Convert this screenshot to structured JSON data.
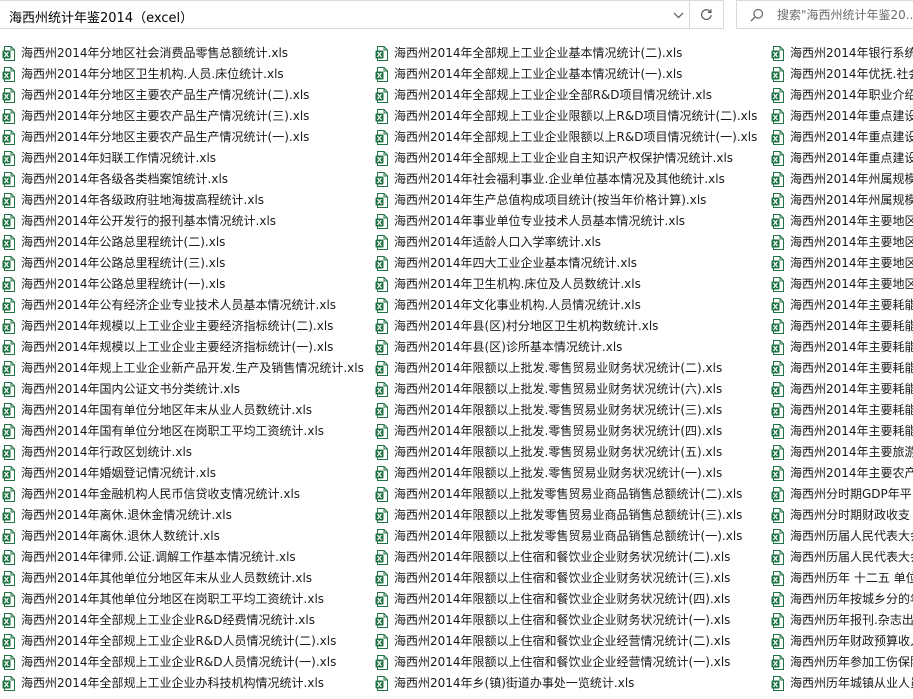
{
  "address": {
    "path_text": "海西州统计年鉴2014（excel）"
  },
  "search": {
    "placeholder": "搜索\"海西州统计年鉴20..."
  },
  "icons": {
    "dropdown": "chevron-down-icon",
    "refresh": "refresh-icon",
    "search": "search-icon",
    "file": "excel-file-icon"
  },
  "colors": {
    "excel_green": "#217346",
    "border": "#d9d9d9"
  },
  "files": {
    "column1": [
      "海西州2014年分地区社会消费品零售总额统计.xls",
      "海西州2014年分地区卫生机构.人员.床位统计.xls",
      "海西州2014年分地区主要农产品生产情况统计(二).xls",
      "海西州2014年分地区主要农产品生产情况统计(三).xls",
      "海西州2014年分地区主要农产品生产情况统计(一).xls",
      "海西州2014年妇联工作情况统计.xls",
      "海西州2014年各级各类档案馆统计.xls",
      "海西州2014年各级政府驻地海拔高程统计.xls",
      "海西州2014年公开发行的报刊基本情况统计.xls",
      "海西州2014年公路总里程统计(二).xls",
      "海西州2014年公路总里程统计(三).xls",
      "海西州2014年公路总里程统计(一).xls",
      "海西州2014年公有经济企业专业技术人员基本情况统计.xls",
      "海西州2014年规模以上工业企业主要经济指标统计(二).xls",
      "海西州2014年规模以上工业企业主要经济指标统计(一).xls",
      "海西州2014年规上工业企业新产品开发.生产及销售情况统计.xls",
      "海西州2014年国内公证文书分类统计.xls",
      "海西州2014年国有单位分地区年末从业人员数统计.xls",
      "海西州2014年国有单位分地区在岗职工平均工资统计.xls",
      "海西州2014年行政区划统计.xls",
      "海西州2014年婚姻登记情况统计.xls",
      "海西州2014年金融机构人民币信贷收支情况统计.xls",
      "海西州2014年离休.退休金情况统计.xls",
      "海西州2014年离休.退休人数统计.xls",
      "海西州2014年律师.公证.调解工作基本情况统计.xls",
      "海西州2014年其他单位分地区年末从业人员数统计.xls",
      "海西州2014年其他单位分地区在岗职工平均工资统计.xls",
      "海西州2014年全部规上工业企业R&D经费情况统计.xls",
      "海西州2014年全部规上工业企业R&D人员情况统计(二).xls",
      "海西州2014年全部规上工业企业R&D人员情况统计(一).xls",
      "海西州2014年全部规上工业企业办科技机构情况统计.xls"
    ],
    "column2": [
      "海西州2014年全部规上工业企业基本情况统计(二).xls",
      "海西州2014年全部规上工业企业基本情况统计(一).xls",
      "海西州2014年全部规上工业企业全部R&D项目情况统计.xls",
      "海西州2014年全部规上工业企业限额以上R&D项目情况统计(二).xls",
      "海西州2014年全部规上工业企业限额以上R&D项目情况统计(一).xls",
      "海西州2014年全部规上工业企业自主知识产权保护情况统计.xls",
      "海西州2014年社会福利事业.企业单位基本情况及其他统计.xls",
      "海西州2014年生产总值构成项目统计(按当年价格计算).xls",
      "海西州2014年事业单位专业技术人员基本情况统计.xls",
      "海西州2014年适龄人口入学率统计.xls",
      "海西州2014年四大工业企业基本情况统计.xls",
      "海西州2014年卫生机构.床位及人员数统计.xls",
      "海西州2014年文化事业机构.人员情况统计.xls",
      "海西州2014年县(区)村分地区卫生机构数统计.xls",
      "海西州2014年县(区)诊所基本情况统计.xls",
      "海西州2014年限额以上批发.零售贸易业财务状况统计(二).xls",
      "海西州2014年限额以上批发.零售贸易业财务状况统计(六).xls",
      "海西州2014年限额以上批发.零售贸易业财务状况统计(三).xls",
      "海西州2014年限额以上批发.零售贸易业财务状况统计(四).xls",
      "海西州2014年限额以上批发.零售贸易业财务状况统计(五).xls",
      "海西州2014年限额以上批发.零售贸易业财务状况统计(一).xls",
      "海西州2014年限额以上批发零售贸易业商品销售总额统计(二).xls",
      "海西州2014年限额以上批发零售贸易业商品销售总额统计(三).xls",
      "海西州2014年限额以上批发零售贸易业商品销售总额统计(一).xls",
      "海西州2014年限额以上住宿和餐饮业企业财务状况统计(二).xls",
      "海西州2014年限额以上住宿和餐饮业企业财务状况统计(三).xls",
      "海西州2014年限额以上住宿和餐饮业企业财务状况统计(四).xls",
      "海西州2014年限额以上住宿和餐饮业企业财务状况统计(一).xls",
      "海西州2014年限额以上住宿和餐饮业企业经营情况统计(二).xls",
      "海西州2014年限额以上住宿和餐饮业企业经营情况统计(一).xls",
      "海西州2014年乡(镇)街道办事处一览统计.xls"
    ],
    "column3": [
      "海西州2014年银行系统",
      "海西州2014年优抚.社会",
      "海西州2014年职业介绍",
      "海西州2014年重点建设",
      "海西州2014年重点建设",
      "海西州2014年重点建设",
      "海西州2014年州属规模",
      "海西州2014年州属规模",
      "海西州2014年主要地区",
      "海西州2014年主要地区",
      "海西州2014年主要地区",
      "海西州2014年主要地区",
      "海西州2014年主要耗能",
      "海西州2014年主要耗能",
      "海西州2014年主要耗能",
      "海西州2014年主要耗能",
      "海西州2014年主要耗能",
      "海西州2014年主要耗能",
      "海西州2014年主要耗能",
      "海西州2014年主要旅游",
      "海西州2014年主要农产",
      "海西州分时期GDP年平",
      "海西州分时期财政收支",
      "海西州历届人民代表大会",
      "海西州历届人民代表大会",
      "海西州历年 十二五 单位",
      "海西州历年按城乡分的年",
      "海西州历年报刊.杂志出",
      "海西州历年财政预算收入",
      "海西州历年参加工伤保险",
      "海西州历年城镇从业人员"
    ]
  }
}
